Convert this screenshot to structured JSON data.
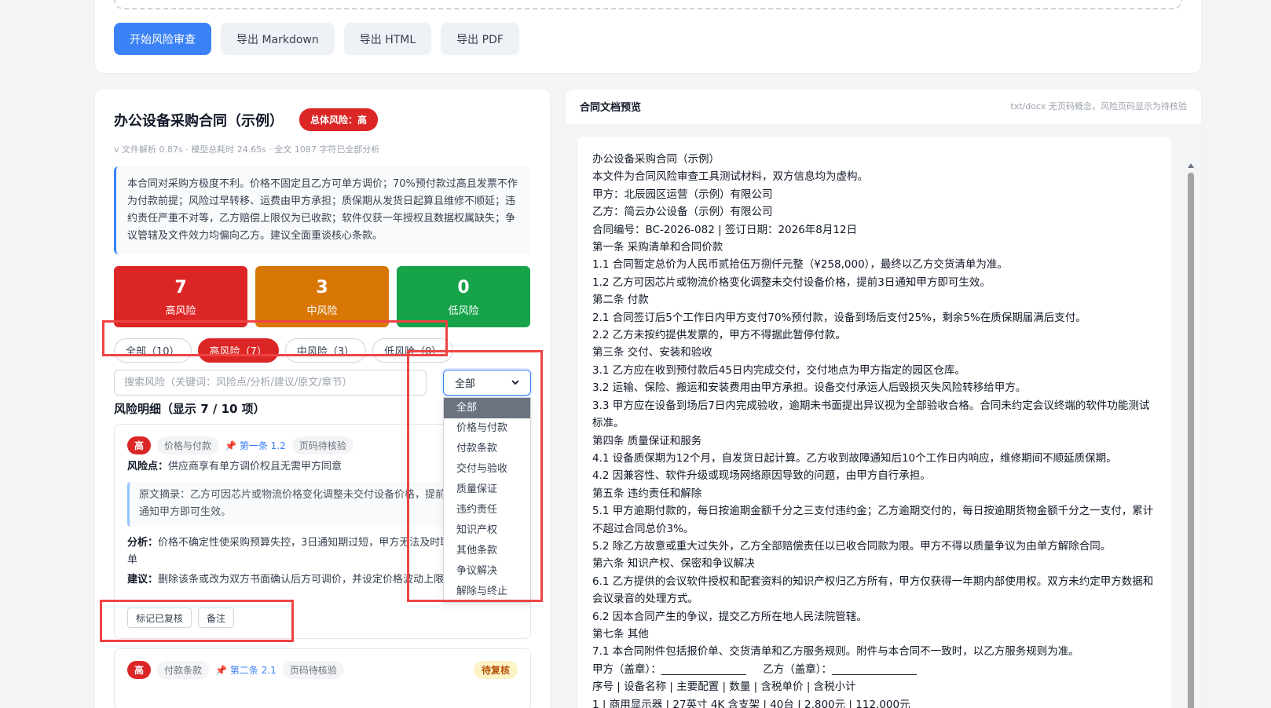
{
  "toolbar": {
    "start_label": "开始风险审查",
    "export_md_label": "导出 Markdown",
    "export_html_label": "导出 HTML",
    "export_pdf_label": "导出 PDF"
  },
  "report": {
    "title": "办公设备采购合同（示例）",
    "overall_badge": "总体风险：高",
    "meta": "v 文件解析 0.87s · 模型总耗时 24.65s · 全文 1087 字符已全部分析",
    "summary": "本合同对采购方极度不利。价格不固定且乙方可单方调价；70%预付款过高且发票不作为付款前提；风险过早转移、运费由甲方承担；质保期从发货日起算且维修不顺延；违约责任严重不对等，乙方赔偿上限仅为已收款；软件仅获一年授权且数据权属缺失；争议管辖及文件效力均偏向乙方。建议全面重谈核心条款。"
  },
  "stats": {
    "high": {
      "count": "7",
      "label": "高风险"
    },
    "mid": {
      "count": "3",
      "label": "中风险"
    },
    "low": {
      "count": "0",
      "label": "低风险"
    }
  },
  "filters": [
    "全部（10）",
    "高风险（7）",
    "中风险（3）",
    "低风险（0）"
  ],
  "active_filter": "高风险（7）",
  "search": {
    "placeholder": "搜索风险（关键词：风险点/分析/建议/原文/章节）"
  },
  "category_select": {
    "value": "全部",
    "options": [
      "全部",
      "价格与付款",
      "付款条款",
      "交付与验收",
      "质量保证",
      "违约责任",
      "知识产权",
      "其他条款",
      "争议解决",
      "解除与终止"
    ]
  },
  "section_title": "风险明细（显示 7 / 10 项）",
  "risks": [
    {
      "level": "高",
      "category": "价格与付款",
      "clause": "第一条 1.2",
      "page": "页码待核验",
      "point_label": "风险点：",
      "point": "供应商享有单方调价权且无需甲方同意",
      "quote_label": "原文摘录：",
      "quote": "乙方可因芯片或物流价格变化调整未交付设备价格，提前3日通知甲方即可生效。",
      "analysis_label": "分析：",
      "analysis": "价格不确定性使采购预算失控，3日通知期过短，甲方无法及时取消订单",
      "advice_label": "建议：",
      "advice": "删除该条或改为双方书面确认后方可调价，并设定价格波动上限",
      "btn_reviewed": "标记已复核",
      "btn_note": "备注"
    },
    {
      "level": "高",
      "category": "付款条款",
      "clause": "第二条 2.1",
      "page": "页码待核验",
      "status": "待复核"
    }
  ],
  "preview": {
    "title": "合同文档预览",
    "note": "txt/docx 无页码概念，风险页码显示为待核验",
    "lines": [
      "办公设备采购合同（示例）",
      "本文件为合同风险审查工具测试材料，双方信息均为虚构。",
      "甲方：北辰园区运营（示例）有限公司",
      "乙方：简云办公设备（示例）有限公司",
      "合同编号：BC-2026-082 | 签订日期：2026年8月12日",
      "第一条 采购清单和合同价款",
      "1.1 合同暂定总价为人民币贰拾伍万捌仟元整（¥258,000），最终以乙方交货清单为准。",
      "1.2 乙方可因芯片或物流价格变化调整未交付设备价格，提前3日通知甲方即可生效。",
      "第二条 付款",
      "2.1 合同签订后5个工作日内甲方支付70%预付款，设备到场后支付25%，剩余5%在质保期届满后支付。",
      "2.2 乙方未按约提供发票的，甲方不得据此暂停付款。",
      "第三条 交付、安装和验收",
      "3.1 乙方应在收到预付款后45日内完成交付，交付地点为甲方指定的园区仓库。",
      "3.2 运输、保险、搬运和安装费用由甲方承担。设备交付承运人后毁损灭失风险转移给甲方。",
      "3.3 甲方应在设备到场后7日内完成验收，逾期未书面提出异议视为全部验收合格。合同未约定会议终端的软件功能测试标准。",
      "第四条 质量保证和服务",
      "4.1 设备质保期为12个月，自发货日起计算。乙方收到故障通知后10个工作日内响应，维修期间不顺延质保期。",
      "4.2 因兼容性、软件升级或现场网络原因导致的问题，由甲方自行承担。",
      "第五条 违约责任和解除",
      "5.1 甲方逾期付款的，每日按逾期金额千分之三支付违约金；乙方逾期交付的，每日按逾期货物金额千分之一支付，累计不超过合同总价3%。",
      "5.2 除乙方故意或重大过失外，乙方全部赔偿责任以已收合同款为限。甲方不得以质量争议为由单方解除合同。",
      "第六条 知识产权、保密和争议解决",
      "6.1 乙方提供的会议软件授权和配套资料的知识产权归乙方所有，甲方仅获得一年期内部使用权。双方未约定甲方数据和会议录音的处理方式。",
      "6.2 因本合同产生的争议，提交乙方所在地人民法院管辖。",
      "第七条 其他",
      "7.1 本合同附件包括报价单、交货清单和乙方服务规则。附件与本合同不一致时，以乙方服务规则为准。",
      "甲方（盖章）：________________     乙方（盖章）：________________",
      "序号 | 设备名称 | 主要配置 | 数量 | 含税单价 | 含税小计",
      "1 | 商用显示器 | 27英寸 4K 含支架 | 40台 | 2,800元 | 112,000元"
    ]
  }
}
